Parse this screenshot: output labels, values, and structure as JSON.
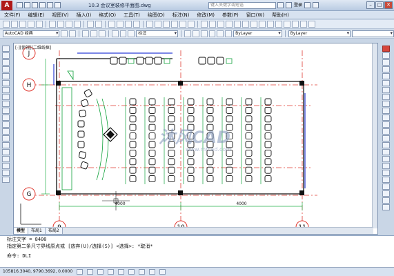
{
  "titlebar": {
    "logo": "A",
    "title": "10.3   会议室装修平面图.dwg",
    "search_placeholder": "键入关键字或短语",
    "login": "登录",
    "win_min": "–",
    "win_max": "□",
    "win_close": "✕"
  },
  "menubar": {
    "items": [
      "文件(F)",
      "编辑(E)",
      "视图(V)",
      "插入(I)",
      "格式(O)",
      "工具(T)",
      "绘图(D)",
      "标注(N)",
      "修改(M)",
      "参数(P)",
      "窗口(W)",
      "帮助(H)"
    ]
  },
  "toolbar2": {
    "workspace": "AutoCAD 经典",
    "text_style": "标注"
  },
  "toolbar3": {
    "layer": "ByLayer",
    "linetype": "ByLayer"
  },
  "canvas": {
    "viewport_label": "[-][俯视][二维线框]",
    "watermark": "沐风CAD",
    "watermark_url": "www.mfcad.com",
    "grid_labels": [
      "H",
      "G",
      "9",
      "10",
      "11",
      "J"
    ],
    "dimensions": [
      "4000",
      "4000"
    ]
  },
  "layout_tabs": [
    "模型",
    "布局1",
    "布局2"
  ],
  "cmdline": {
    "line1": "标注文字 = 8400",
    "line2": "指定第二条尺寸界线原点或 [放弃(U)/选择(S)] <选择>: *取消*",
    "prompt": "命令: DLI"
  },
  "statusbar": {
    "coords": "105816.3040, 9790.3692, 0.0000"
  },
  "colors": {
    "grid_red": "#e0382f",
    "wall_black": "#111111",
    "furniture_green": "#0fa13a",
    "dim_green": "#23b04a",
    "window_blue": "#2b3fd6",
    "watermark": "#7f93b8"
  }
}
